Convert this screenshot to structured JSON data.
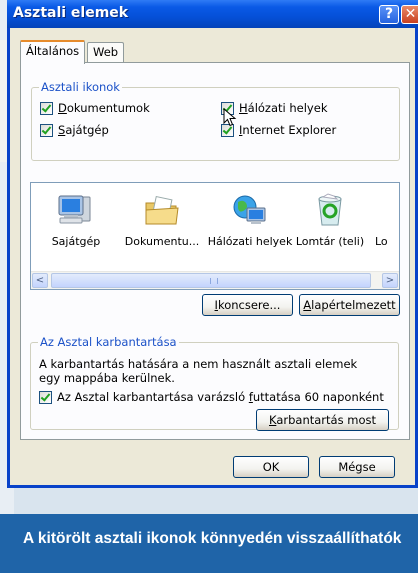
{
  "window": {
    "title": "Asztali elemek",
    "help": "?",
    "close": "✕"
  },
  "tabs": [
    {
      "label": "Általános",
      "active": true
    },
    {
      "label": "Web",
      "active": false
    }
  ],
  "desktop_icons": {
    "legend": "Asztali ikonok",
    "checkboxes": [
      {
        "pre": "",
        "u": "D",
        "post": "okumentumok",
        "checked": true
      },
      {
        "pre": "",
        "u": "H",
        "post": "álózati helyek",
        "checked": true
      },
      {
        "pre": "",
        "u": "S",
        "post": "ajátgép",
        "checked": true
      },
      {
        "pre": "",
        "u": "I",
        "post": "nternet Explorer",
        "checked": true
      }
    ]
  },
  "icon_list": {
    "items": [
      {
        "label": "Sajátgép",
        "icon": "my-computer-icon"
      },
      {
        "label": "Dokumentu...",
        "icon": "documents-folder-icon"
      },
      {
        "label": "Hálózati helyek",
        "icon": "network-places-icon"
      },
      {
        "label": "Lomtár (teli)",
        "icon": "recycle-bin-full-icon"
      },
      {
        "label": "Lo",
        "icon": "recycle-bin-empty-icon"
      }
    ],
    "scroll_left": "<",
    "scroll_right": ">"
  },
  "buttons": {
    "change_icon_u": "I",
    "change_icon_rest": "koncsere...",
    "default_u": "A",
    "default_rest": "lapértelmezett",
    "cleanup_u": "K",
    "cleanup_rest": "arbantartás most",
    "ok": "OK",
    "cancel": "Mégse"
  },
  "cleanup": {
    "legend": "Az Asztal karbantartása",
    "description": "A karbantartás hatására a nem használt asztali elemek egy mappába kerülnek.",
    "checkbox_pre": "Az Asztal karbantartása varázsló ",
    "checkbox_u": "f",
    "checkbox_post": "uttatása 60 naponként",
    "checked": true
  },
  "caption": "A kitörölt asztali ikonok könnyedén visszaállíthatók",
  "colors": {
    "titlebar": "#0550d8",
    "caption_bg": "#1f64a8",
    "group_legend": "#1c52c8"
  }
}
